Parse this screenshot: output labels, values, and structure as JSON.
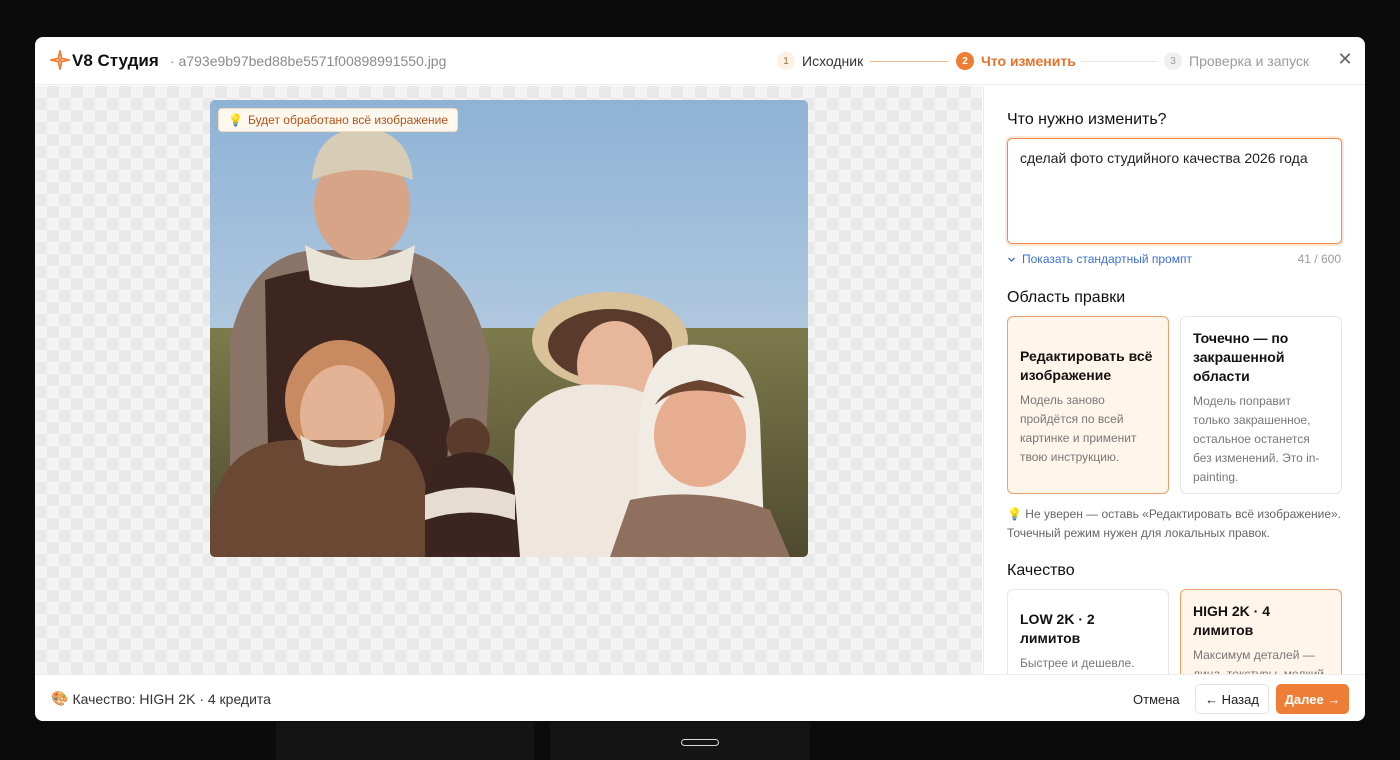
{
  "header": {
    "brand": "V8 Студия",
    "filename": "· a793e9b97bed88be5571f00898991550.jpg",
    "steps": [
      {
        "num": "1",
        "label": "Исходник"
      },
      {
        "num": "2",
        "label": "Что изменить"
      },
      {
        "num": "3",
        "label": "Проверка и запуск"
      }
    ],
    "active_step": 2,
    "close_glyph": "✕"
  },
  "canvas": {
    "badge_icon": "💡",
    "badge_text": "Будет обработано всё изображение"
  },
  "panel": {
    "prompt_heading": "Что нужно изменить?",
    "prompt_value": "сделай фото студийного качества 2026 года",
    "show_default_label": "Показать стандартный промпт",
    "char_counter": "41 / 600",
    "area_heading": "Область правки",
    "area_options": [
      {
        "title": "Редактировать всё изображение",
        "desc": "Модель заново пройдётся по всей картинке и применит твою инструкцию.",
        "selected": true
      },
      {
        "title": "Точечно — по закрашенной области",
        "desc": "Модель поправит только закрашенное, остальное останется без изменений. Это in-painting.",
        "selected": false
      }
    ],
    "area_hint": "💡 Не уверен — оставь «Редактировать всё изображение». Точечный режим нужен для локальных правок.",
    "quality_heading": "Качество",
    "quality_options": [
      {
        "title": "LOW 2K · 2 лимитов",
        "desc": "Быстрее и дешевле. Обычно этого",
        "selected": false
      },
      {
        "title": "HIGH 2K · 4 лимитов",
        "desc": "Максимум деталей — лица, текстуры, мелкий текст. Подходит для",
        "selected": true
      }
    ]
  },
  "footer": {
    "quality_icon": "🎨",
    "quality_text": "Качество: HIGH 2K · 4 кредита",
    "cancel_label": "Отмена",
    "back_label": "← Назад",
    "next_label": "Далее →"
  },
  "colors": {
    "accent": "#ee7d35",
    "accent_bg": "#fff5eb",
    "link": "#3b6fd4"
  },
  "icons": {
    "logo": "sparkle-icon",
    "close": "close-icon",
    "hint": "lightbulb-icon",
    "expand": "chevron-down-icon",
    "quality": "palette-icon"
  }
}
